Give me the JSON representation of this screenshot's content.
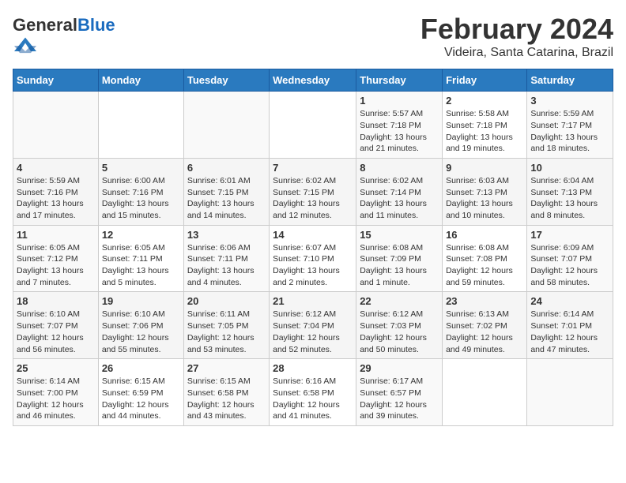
{
  "logo": {
    "general": "General",
    "blue": "Blue"
  },
  "header": {
    "title": "February 2024",
    "subtitle": "Videira, Santa Catarina, Brazil"
  },
  "columns": [
    "Sunday",
    "Monday",
    "Tuesday",
    "Wednesday",
    "Thursday",
    "Friday",
    "Saturday"
  ],
  "weeks": [
    {
      "days": [
        {
          "num": "",
          "info": ""
        },
        {
          "num": "",
          "info": ""
        },
        {
          "num": "",
          "info": ""
        },
        {
          "num": "",
          "info": ""
        },
        {
          "num": "1",
          "info": "Sunrise: 5:57 AM\nSunset: 7:18 PM\nDaylight: 13 hours\nand 21 minutes."
        },
        {
          "num": "2",
          "info": "Sunrise: 5:58 AM\nSunset: 7:18 PM\nDaylight: 13 hours\nand 19 minutes."
        },
        {
          "num": "3",
          "info": "Sunrise: 5:59 AM\nSunset: 7:17 PM\nDaylight: 13 hours\nand 18 minutes."
        }
      ]
    },
    {
      "days": [
        {
          "num": "4",
          "info": "Sunrise: 5:59 AM\nSunset: 7:16 PM\nDaylight: 13 hours\nand 17 minutes."
        },
        {
          "num": "5",
          "info": "Sunrise: 6:00 AM\nSunset: 7:16 PM\nDaylight: 13 hours\nand 15 minutes."
        },
        {
          "num": "6",
          "info": "Sunrise: 6:01 AM\nSunset: 7:15 PM\nDaylight: 13 hours\nand 14 minutes."
        },
        {
          "num": "7",
          "info": "Sunrise: 6:02 AM\nSunset: 7:15 PM\nDaylight: 13 hours\nand 12 minutes."
        },
        {
          "num": "8",
          "info": "Sunrise: 6:02 AM\nSunset: 7:14 PM\nDaylight: 13 hours\nand 11 minutes."
        },
        {
          "num": "9",
          "info": "Sunrise: 6:03 AM\nSunset: 7:13 PM\nDaylight: 13 hours\nand 10 minutes."
        },
        {
          "num": "10",
          "info": "Sunrise: 6:04 AM\nSunset: 7:13 PM\nDaylight: 13 hours\nand 8 minutes."
        }
      ]
    },
    {
      "days": [
        {
          "num": "11",
          "info": "Sunrise: 6:05 AM\nSunset: 7:12 PM\nDaylight: 13 hours\nand 7 minutes."
        },
        {
          "num": "12",
          "info": "Sunrise: 6:05 AM\nSunset: 7:11 PM\nDaylight: 13 hours\nand 5 minutes."
        },
        {
          "num": "13",
          "info": "Sunrise: 6:06 AM\nSunset: 7:11 PM\nDaylight: 13 hours\nand 4 minutes."
        },
        {
          "num": "14",
          "info": "Sunrise: 6:07 AM\nSunset: 7:10 PM\nDaylight: 13 hours\nand 2 minutes."
        },
        {
          "num": "15",
          "info": "Sunrise: 6:08 AM\nSunset: 7:09 PM\nDaylight: 13 hours\nand 1 minute."
        },
        {
          "num": "16",
          "info": "Sunrise: 6:08 AM\nSunset: 7:08 PM\nDaylight: 12 hours\nand 59 minutes."
        },
        {
          "num": "17",
          "info": "Sunrise: 6:09 AM\nSunset: 7:07 PM\nDaylight: 12 hours\nand 58 minutes."
        }
      ]
    },
    {
      "days": [
        {
          "num": "18",
          "info": "Sunrise: 6:10 AM\nSunset: 7:07 PM\nDaylight: 12 hours\nand 56 minutes."
        },
        {
          "num": "19",
          "info": "Sunrise: 6:10 AM\nSunset: 7:06 PM\nDaylight: 12 hours\nand 55 minutes."
        },
        {
          "num": "20",
          "info": "Sunrise: 6:11 AM\nSunset: 7:05 PM\nDaylight: 12 hours\nand 53 minutes."
        },
        {
          "num": "21",
          "info": "Sunrise: 6:12 AM\nSunset: 7:04 PM\nDaylight: 12 hours\nand 52 minutes."
        },
        {
          "num": "22",
          "info": "Sunrise: 6:12 AM\nSunset: 7:03 PM\nDaylight: 12 hours\nand 50 minutes."
        },
        {
          "num": "23",
          "info": "Sunrise: 6:13 AM\nSunset: 7:02 PM\nDaylight: 12 hours\nand 49 minutes."
        },
        {
          "num": "24",
          "info": "Sunrise: 6:14 AM\nSunset: 7:01 PM\nDaylight: 12 hours\nand 47 minutes."
        }
      ]
    },
    {
      "days": [
        {
          "num": "25",
          "info": "Sunrise: 6:14 AM\nSunset: 7:00 PM\nDaylight: 12 hours\nand 46 minutes."
        },
        {
          "num": "26",
          "info": "Sunrise: 6:15 AM\nSunset: 6:59 PM\nDaylight: 12 hours\nand 44 minutes."
        },
        {
          "num": "27",
          "info": "Sunrise: 6:15 AM\nSunset: 6:58 PM\nDaylight: 12 hours\nand 43 minutes."
        },
        {
          "num": "28",
          "info": "Sunrise: 6:16 AM\nSunset: 6:58 PM\nDaylight: 12 hours\nand 41 minutes."
        },
        {
          "num": "29",
          "info": "Sunrise: 6:17 AM\nSunset: 6:57 PM\nDaylight: 12 hours\nand 39 minutes."
        },
        {
          "num": "",
          "info": ""
        },
        {
          "num": "",
          "info": ""
        }
      ]
    }
  ]
}
